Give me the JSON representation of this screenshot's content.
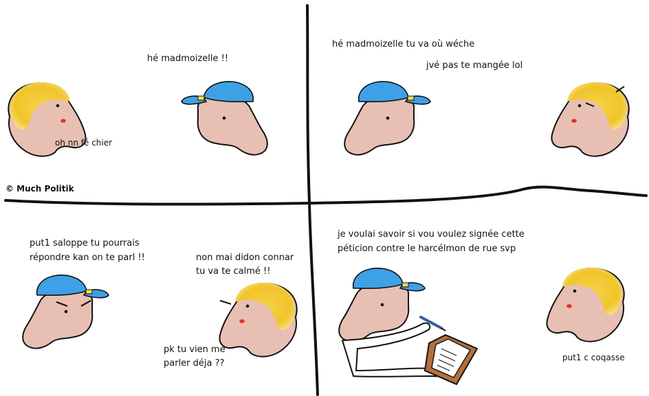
{
  "credit": "© Much Politik",
  "panels": {
    "p1": {
      "man_speech": "hé madmoizelle !!",
      "woman_speech": "oh nn fé chier"
    },
    "p2": {
      "man_speech_1": "hé madmoizelle tu va où wéche",
      "man_speech_2": "jvé pas te mangée lol"
    },
    "p3": {
      "man_speech_line1": "put1 saloppe tu pourrais",
      "man_speech_line2": "répondre kan on te parl !!",
      "woman_speech_line1": "non mai didon connar",
      "woman_speech_line2": "tu va te calmé !!",
      "man_speech_2_line1": "pk tu vien me",
      "man_speech_2_line2": "parler déja ??"
    },
    "p4": {
      "man_speech_line1": "je voulai savoir si vou voulez signée cette",
      "man_speech_line2": "péticion contre le harcélmon de rue svp",
      "woman_speech": "put1 c coqasse"
    }
  },
  "colors": {
    "skin": "#e8bfb3",
    "hair": "#f2c832",
    "cap": "#3ea0e6",
    "lips": "#e8302a",
    "ink": "#111111"
  },
  "icons": {
    "cap_badge": "cap-badge-icon",
    "pen": "pen-icon",
    "clipboard": "clipboard-icon"
  }
}
